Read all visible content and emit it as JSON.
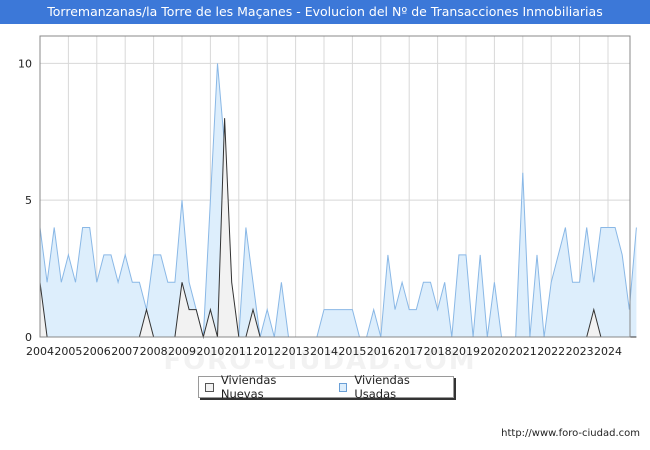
{
  "title": "Torremanzanas/la Torre de les Maçanes - Evolucion del Nº de Transacciones Inmobiliarias",
  "footer": "http://www.foro-ciudad.com",
  "watermark": "FORO-CIUDAD.COM",
  "colors": {
    "header_bg": "#3c78d8",
    "usadas_fill": "#ddeefc",
    "usadas_line": "#8ab8e6",
    "nuevas_fill": "#f2f2f2",
    "nuevas_line": "#333333",
    "grid": "#d8d8d8"
  },
  "chart_data": {
    "type": "area",
    "title": "Torremanzanas/la Torre de les Maçanes - Evolucion del Nº de Transacciones Inmobiliarias",
    "x_unit": "quarter",
    "x_start": "2004",
    "x_tick_labels": [
      "2004",
      "2005",
      "2006",
      "2007",
      "2008",
      "2009",
      "2010",
      "2011",
      "2012",
      "2013",
      "2014",
      "2015",
      "2016",
      "2017",
      "2018",
      "2019",
      "2020",
      "2021",
      "2022",
      "2023",
      "2024"
    ],
    "y_ticks": [
      0,
      5,
      10
    ],
    "ylim": [
      0,
      11
    ],
    "grid": true,
    "legend_position": "bottom-center",
    "series": [
      {
        "name": "Viviendas Usadas",
        "values": [
          4,
          2,
          4,
          2,
          3,
          2,
          4,
          4,
          2,
          3,
          3,
          2,
          3,
          2,
          2,
          1,
          3,
          3,
          2,
          2,
          5,
          2,
          1,
          0,
          5,
          10,
          7,
          1,
          0,
          4,
          2,
          0,
          1,
          0,
          2,
          0,
          0,
          0,
          0,
          0,
          1,
          1,
          1,
          1,
          1,
          0,
          0,
          1,
          0,
          3,
          1,
          2,
          1,
          1,
          2,
          2,
          1,
          2,
          0,
          3,
          3,
          0,
          3,
          0,
          2,
          0,
          0,
          0,
          6,
          0,
          3,
          0,
          2,
          3,
          4,
          2,
          2,
          4,
          2,
          4,
          4,
          4,
          3,
          1,
          4
        ]
      },
      {
        "name": "Viviendas Nuevas",
        "values": [
          2,
          0,
          0,
          0,
          0,
          0,
          0,
          0,
          0,
          0,
          0,
          0,
          0,
          0,
          0,
          1,
          0,
          0,
          0,
          0,
          2,
          1,
          1,
          0,
          1,
          0,
          8,
          2,
          0,
          0,
          1,
          0,
          0,
          0,
          0,
          0,
          0,
          0,
          0,
          0,
          0,
          0,
          0,
          0,
          0,
          0,
          0,
          0,
          0,
          0,
          0,
          0,
          0,
          0,
          0,
          0,
          0,
          0,
          0,
          0,
          0,
          0,
          0,
          0,
          0,
          0,
          0,
          0,
          0,
          0,
          0,
          0,
          0,
          0,
          0,
          0,
          0,
          0,
          1,
          0,
          0,
          0,
          0,
          0,
          0
        ]
      }
    ]
  },
  "legend": {
    "nuevas_label": "Viviendas Nuevas",
    "usadas_label": "Viviendas Usadas"
  }
}
